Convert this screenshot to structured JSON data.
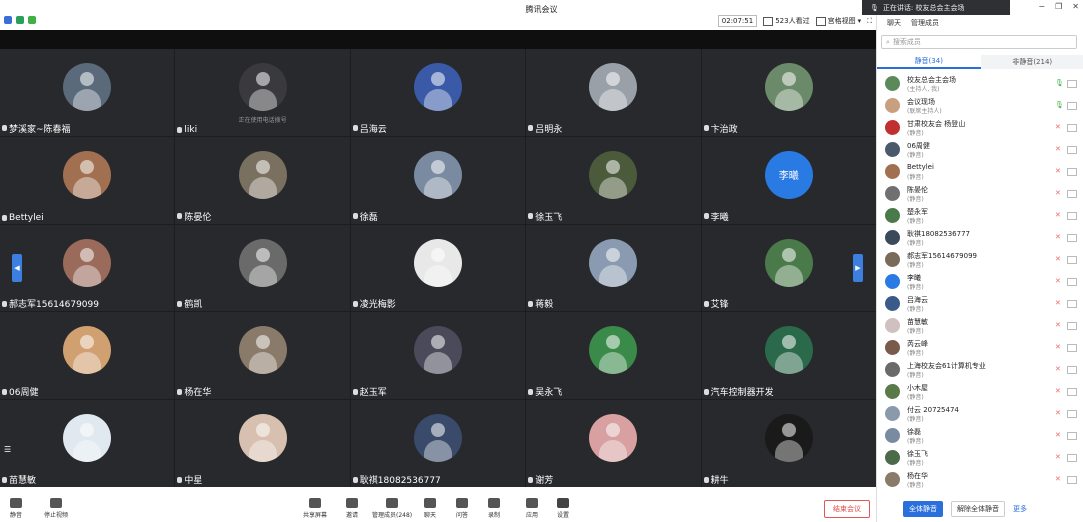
{
  "app": {
    "title": "腾讯会议"
  },
  "toolbar_top": {
    "timer": "02:07:51",
    "attendees": "523人看过",
    "view": "宫格视图"
  },
  "speaking": {
    "text": "正在讲话: 校友总会主会场"
  },
  "panel": {
    "tab_chat": "聊天",
    "tab_manage": "管理成员",
    "search_placeholder": "搜索成员",
    "seg_muted": "静音(34)",
    "seg_unmuted": "非静音(214)",
    "members": [
      {
        "name": "校友总会主会场",
        "role": "(主持人, 我)",
        "color": "#5a8a5a",
        "mic": "on"
      },
      {
        "name": "会议现场",
        "role": "(联席主持人)",
        "color": "#c8a080",
        "mic": "on"
      },
      {
        "name": "甘肃校友会 杨登山",
        "role": "(静音)",
        "color": "#c03030",
        "mic": "off"
      },
      {
        "name": "06周健",
        "role": "(静音)",
        "color": "#4a5a6a",
        "mic": "off"
      },
      {
        "name": "Bettylei",
        "role": "(静音)",
        "color": "#a07050",
        "mic": "off"
      },
      {
        "name": "陈晏伦",
        "role": "(静音)",
        "color": "#707070",
        "mic": "off"
      },
      {
        "name": "楚永军",
        "role": "(静音)",
        "color": "#4a7a4a",
        "mic": "off"
      },
      {
        "name": "耿祺18082536777",
        "role": "(静音)",
        "color": "#3a4a5a",
        "mic": "off"
      },
      {
        "name": "郝志军15614679099",
        "role": "(静音)",
        "color": "#7a6a5a",
        "mic": "off"
      },
      {
        "name": "李曦",
        "role": "(静音)",
        "color": "#2a7ae4",
        "mic": "off"
      },
      {
        "name": "吕海云",
        "role": "(静音)",
        "color": "#3a5a8a",
        "mic": "off"
      },
      {
        "name": "苗慧敏",
        "role": "(静音)",
        "color": "#d0c0c0",
        "mic": "off"
      },
      {
        "name": "芮云峰",
        "role": "(静音)",
        "color": "#7a5a4a",
        "mic": "off"
      },
      {
        "name": "上海校友会61计算机专业",
        "role": "(静音)",
        "color": "#6a6a6a",
        "mic": "off"
      },
      {
        "name": "小木屋",
        "role": "(静音)",
        "color": "#5a7a4a",
        "mic": "off"
      },
      {
        "name": "付云 20725474",
        "role": "(静音)",
        "color": "#8a9aaa",
        "mic": "off"
      },
      {
        "name": "徐磊",
        "role": "(静音)",
        "color": "#7a8aa0",
        "mic": "off"
      },
      {
        "name": "徐玉飞",
        "role": "(静音)",
        "color": "#4a6a4a",
        "mic": "off"
      },
      {
        "name": "杨在华",
        "role": "(静音)",
        "color": "#8a7a6a",
        "mic": "off"
      }
    ],
    "btn_mute_all": "全体静音",
    "btn_unmute_all": "解除全体静音",
    "btn_more": "更多"
  },
  "tiles": [
    {
      "name": "梦溪家~陈春福",
      "color": "#5a6a7a",
      "sub": ""
    },
    {
      "name": "liki",
      "color": "#3a3a3e",
      "sub": "正在使用电话拨号"
    },
    {
      "name": "吕海云",
      "color": "#3a5aa8",
      "sub": ""
    },
    {
      "name": "吕明永",
      "color": "#9aa0a8",
      "sub": ""
    },
    {
      "name": "卞治政",
      "color": "#6a8a6a",
      "sub": ""
    },
    {
      "name": "Bettylei",
      "color": "#a07050",
      "sub": ""
    },
    {
      "name": "陈晏伦",
      "color": "#7a7060",
      "sub": ""
    },
    {
      "name": "徐磊",
      "color": "#7a8aa0",
      "sub": ""
    },
    {
      "name": "徐玉飞",
      "color": "#4a5a3a",
      "sub": ""
    },
    {
      "name": "李曦",
      "color": "#2a7ae4",
      "sub": "李曦"
    },
    {
      "name": "郝志军15614679099",
      "color": "#9a6a5a",
      "sub": ""
    },
    {
      "name": "鹤凯",
      "color": "#6a6a6a",
      "sub": ""
    },
    {
      "name": "凌光梅影",
      "color": "#e8e8e8",
      "sub": ""
    },
    {
      "name": "蒋毅",
      "color": "#8a9ab0",
      "sub": ""
    },
    {
      "name": "艾锋",
      "color": "#4a7a4a",
      "sub": ""
    },
    {
      "name": "06周健",
      "color": "#d0a070",
      "sub": ""
    },
    {
      "name": "杨在华",
      "color": "#8a7a6a",
      "sub": ""
    },
    {
      "name": "赵玉军",
      "color": "#4a4a5a",
      "sub": ""
    },
    {
      "name": "吴永飞",
      "color": "#3a8a4a",
      "sub": ""
    },
    {
      "name": "汽车控制器开发",
      "color": "#2a6a4a",
      "sub": ""
    },
    {
      "name": "苗慧敏",
      "color": "#e0e8f0",
      "sub": ""
    },
    {
      "name": "中星",
      "color": "#d8c0b0",
      "sub": ""
    },
    {
      "name": "耿祺18082536777",
      "color": "#3a4a6a",
      "sub": ""
    },
    {
      "name": "谢芳",
      "color": "#d8a0a0",
      "sub": ""
    },
    {
      "name": "耕牛",
      "color": "#1a1a1a",
      "sub": ""
    }
  ],
  "toolbar": {
    "mute": "静音",
    "stop_video": "停止视频",
    "share": "共享屏幕",
    "invite": "邀请",
    "members": "管理成员(248)",
    "chat": "聊天",
    "qa": "问答",
    "record": "录制",
    "apps": "应用",
    "settings": "设置",
    "end": "结束会议"
  }
}
